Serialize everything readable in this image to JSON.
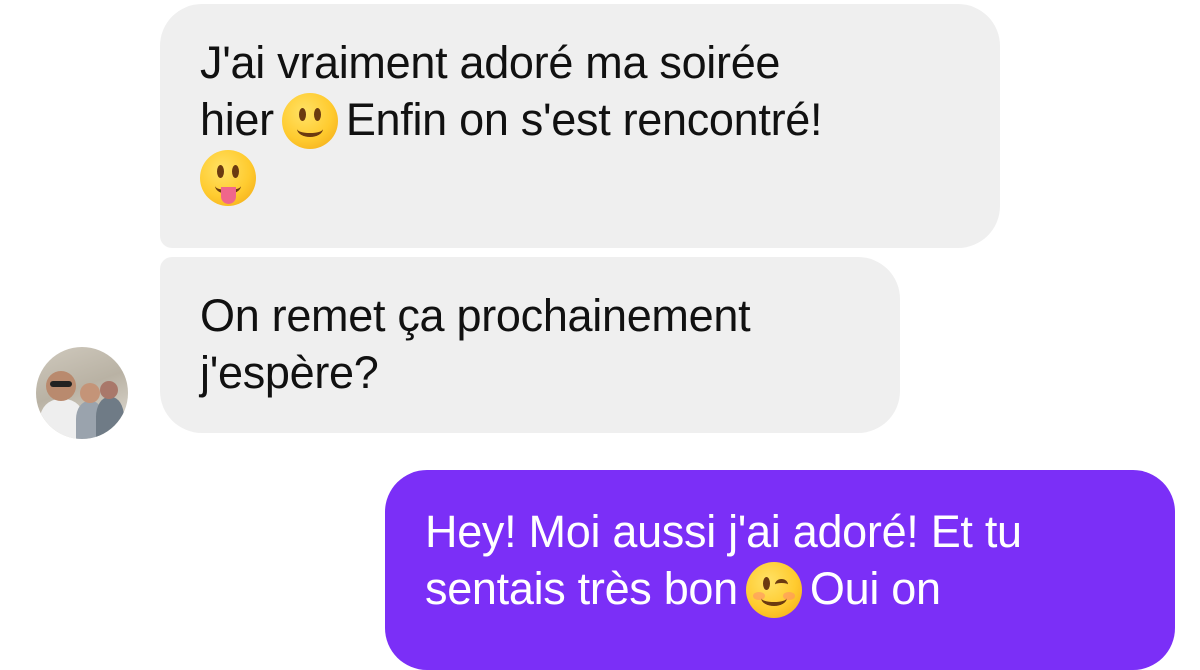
{
  "conversation": {
    "messages": [
      {
        "sender": "contact",
        "lines": [
          [
            "J'ai vraiment adoré ma soirée",
            null,
            ""
          ],
          [
            "hier",
            "slightly-smiling-face-emoji",
            "Enfin on s'est rencontré!"
          ],
          [
            "",
            "face-with-tongue-emoji",
            ""
          ]
        ]
      },
      {
        "sender": "contact",
        "lines": [
          [
            "On remet ça prochainement",
            null,
            ""
          ],
          [
            "j'espère?",
            null,
            ""
          ]
        ]
      },
      {
        "sender": "me",
        "lines": [
          [
            "Hey! Moi aussi j'ai adoré! Et tu",
            null,
            ""
          ],
          [
            "sentais très bon",
            "winking-face-emoji",
            "Oui on"
          ]
        ]
      }
    ]
  },
  "colors": {
    "incoming_bubble": "#efefef",
    "outgoing_bubble": "#7b2ff7",
    "incoming_text": "#111111",
    "outgoing_text": "#ffffff"
  }
}
